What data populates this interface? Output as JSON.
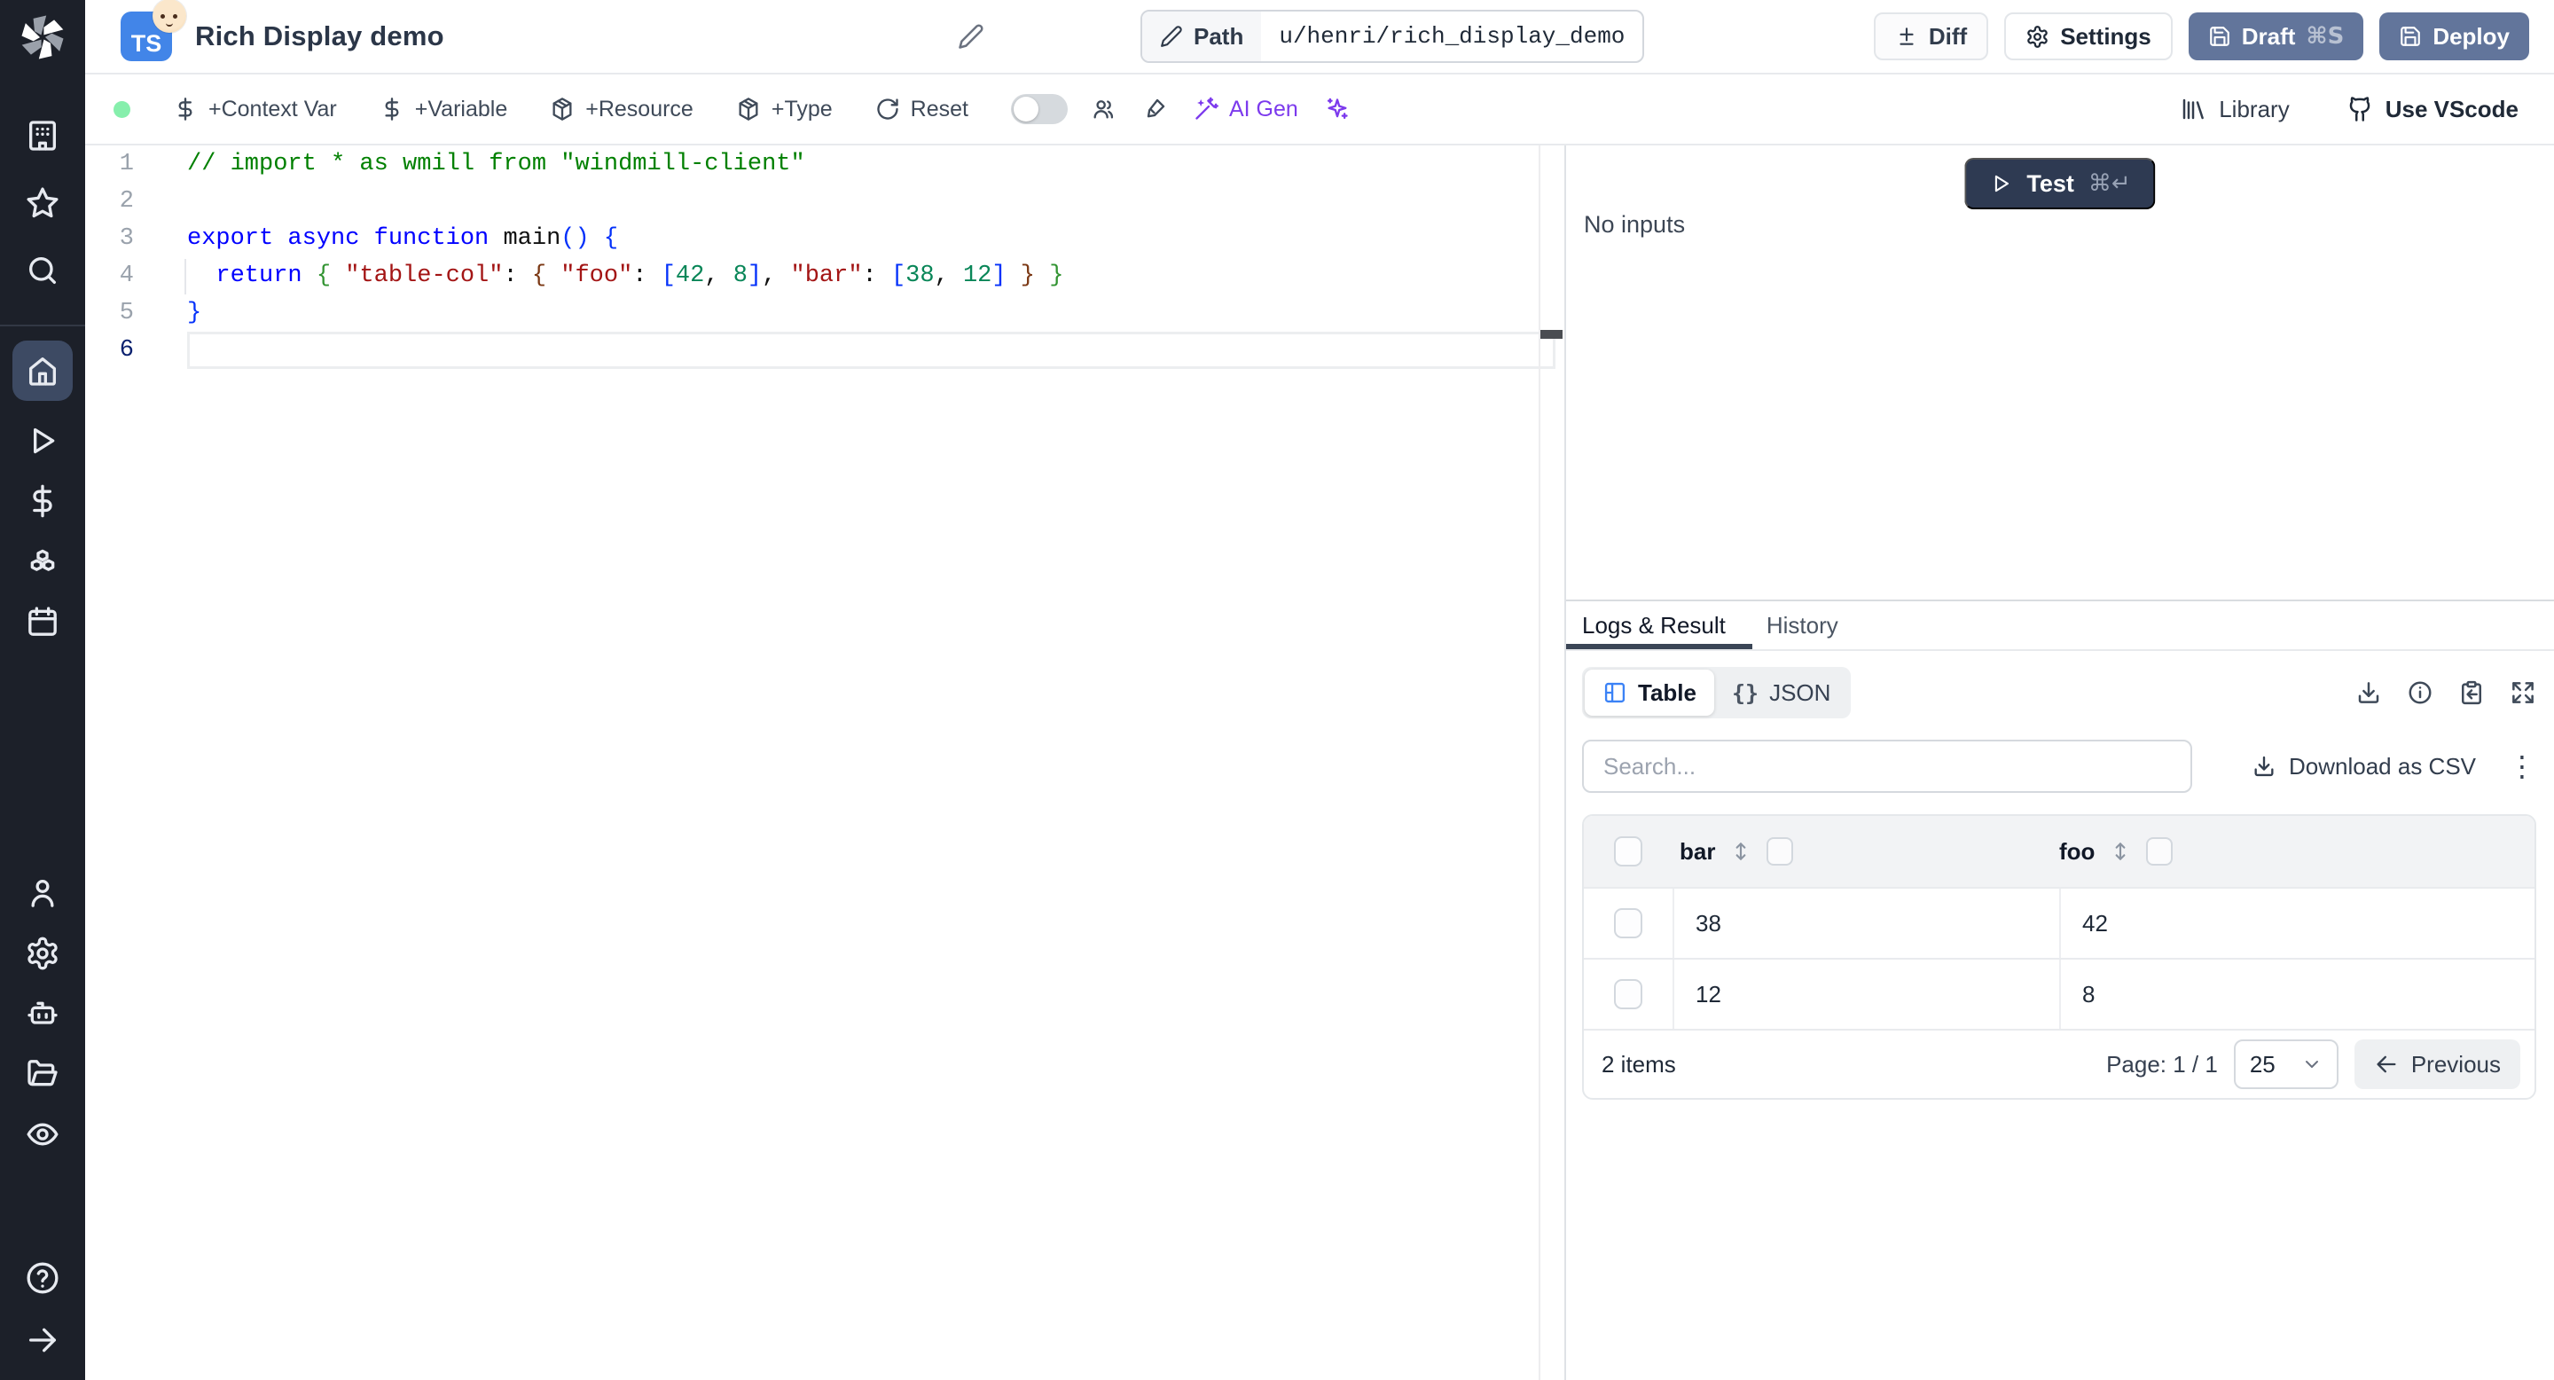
{
  "colors": {
    "sidebar_bg": "#1c2029",
    "sidebar_active_bg": "#3d4a63",
    "slate_button_bg": "#62759b",
    "test_button_bg": "#2e3a52",
    "ai_purple": "#7c3aed",
    "live_dot_green": "#86efac",
    "ts_badge_blue": "#4285e8",
    "table_icon_blue": "#3b82f6",
    "code_comment": "#008000",
    "code_keyword": "#0000ff",
    "code_string": "#a31515",
    "code_number": "#098658",
    "code_bracket1": "#0431fa",
    "code_bracket2": "#319331",
    "code_bracket3": "#7b3814"
  },
  "sidebar": {
    "icons_top": [
      "windmill-logo",
      "building-icon",
      "star-icon",
      "search-icon"
    ],
    "icons_middle": [
      "home-icon (active)",
      "play-icon",
      "dollar-icon",
      "boxes-icon",
      "calendar-icon"
    ],
    "icons_lower": [
      "user-icon",
      "gear-icon",
      "worker-robot-icon",
      "folder-open-icon",
      "eye-icon"
    ],
    "icons_bottom": [
      "help-circle-icon",
      "arrow-right-icon"
    ]
  },
  "topbar": {
    "language_badge": "TS",
    "title": "Rich Display demo",
    "path_label": "Path",
    "path_value": "u/henri/rich_display_demo",
    "diff_label": "Diff",
    "settings_label": "Settings",
    "draft_label": "Draft",
    "draft_shortcut": "⌘S",
    "deploy_label": "Deploy"
  },
  "toolbar": {
    "add_context_var": "+Context Var",
    "add_variable": "+Variable",
    "add_resource": "+Resource",
    "add_type": "+Type",
    "reset": "Reset",
    "ai_gen": "AI Gen",
    "library": "Library",
    "use_vscode": "Use VScode"
  },
  "editor": {
    "active_line": 6,
    "lines": [
      {
        "tokens": [
          {
            "t": "// import * as wmill from \"windmill-client\"",
            "c": "comment"
          }
        ]
      },
      {
        "tokens": []
      },
      {
        "tokens": [
          {
            "t": "export async function ",
            "c": "kw"
          },
          {
            "t": "main",
            "c": "pl"
          },
          {
            "t": "() {",
            "c": "b1"
          }
        ]
      },
      {
        "tokens": [
          {
            "t": "  ",
            "c": "pl"
          },
          {
            "t": "return ",
            "c": "kw"
          },
          {
            "t": "{ ",
            "c": "b2"
          },
          {
            "t": "\"table-col\"",
            "c": "str"
          },
          {
            "t": ": ",
            "c": "pl"
          },
          {
            "t": "{ ",
            "c": "b3"
          },
          {
            "t": "\"foo\"",
            "c": "str"
          },
          {
            "t": ": ",
            "c": "pl"
          },
          {
            "t": "[",
            "c": "b1"
          },
          {
            "t": "42",
            "c": "num"
          },
          {
            "t": ", ",
            "c": "pl"
          },
          {
            "t": "8",
            "c": "num"
          },
          {
            "t": "]",
            "c": "b1"
          },
          {
            "t": ", ",
            "c": "pl"
          },
          {
            "t": "\"bar\"",
            "c": "str"
          },
          {
            "t": ": ",
            "c": "pl"
          },
          {
            "t": "[",
            "c": "b1"
          },
          {
            "t": "38",
            "c": "num"
          },
          {
            "t": ", ",
            "c": "pl"
          },
          {
            "t": "12",
            "c": "num"
          },
          {
            "t": "]",
            "c": "b1"
          },
          {
            "t": " ",
            "c": "pl"
          },
          {
            "t": "}",
            "c": "b3"
          },
          {
            "t": " ",
            "c": "pl"
          },
          {
            "t": "}",
            "c": "b2"
          }
        ]
      },
      {
        "tokens": [
          {
            "t": "}",
            "c": "b1"
          }
        ]
      },
      {
        "tokens": []
      }
    ]
  },
  "run_panel": {
    "test_label": "Test",
    "test_shortcut": "⌘↵",
    "no_inputs": "No inputs",
    "logs_tab": "Logs & Result",
    "history_tab": "History"
  },
  "result_table": {
    "view_table_label": "Table",
    "view_json_label": "JSON",
    "json_braces_glyph": "{}",
    "kebab_glyph": "⋮",
    "toolbar_icons": [
      "download-icon",
      "info-icon",
      "clipboard-paste-icon",
      "expand-icon"
    ],
    "search_placeholder": "Search...",
    "download_csv_label": "Download as CSV",
    "columns": [
      "bar",
      "foo"
    ],
    "rows": [
      [
        "38",
        "42"
      ],
      [
        "12",
        "8"
      ]
    ],
    "items_count": "2 items",
    "page_label": "Page: 1 / 1",
    "page_size": "25",
    "prev_label": "Previous"
  }
}
